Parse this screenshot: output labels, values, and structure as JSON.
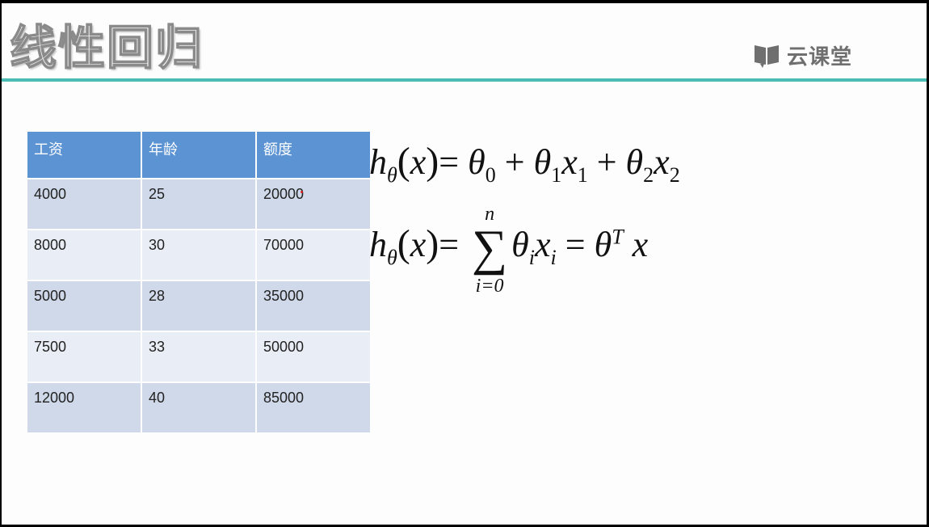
{
  "slide": {
    "title": "线性回归",
    "logo_text": "云课堂"
  },
  "colors": {
    "accent_rule": "#4bbcb3",
    "header_fill": "#5b93d3",
    "row_odd": "#d0d9e9",
    "row_even": "#e9edf5"
  },
  "table": {
    "headers": [
      "工资",
      "年龄",
      "额度"
    ],
    "rows": [
      [
        "4000",
        "25",
        "20000"
      ],
      [
        "8000",
        "30",
        "70000"
      ],
      [
        "5000",
        "28",
        "35000"
      ],
      [
        "7500",
        "33",
        "50000"
      ],
      [
        "12000",
        "40",
        "85000"
      ]
    ]
  },
  "formulas": {
    "f1": {
      "h": "h",
      "h_sub": "θ",
      "x": "x",
      "eq": "=",
      "t0": "θ",
      "t0_sub": "0",
      "plus1": "+",
      "t1": "θ",
      "t1_sub": "1",
      "x1": "x",
      "x1_sub": "1",
      "plus2": "+",
      "t2": "θ",
      "t2_sub": "2",
      "x2": "x",
      "x2_sub": "2"
    },
    "f2": {
      "h": "h",
      "h_sub": "θ",
      "x": "x",
      "eq": "=",
      "sum_symbol": "∑",
      "sum_upper": "n",
      "sum_lower": "i=0",
      "ti": "θ",
      "ti_sub": "i",
      "xi": "x",
      "xi_sub": "i",
      "eq2": "=",
      "tT": "θ",
      "tT_sup": "T",
      "xT": "x"
    }
  }
}
